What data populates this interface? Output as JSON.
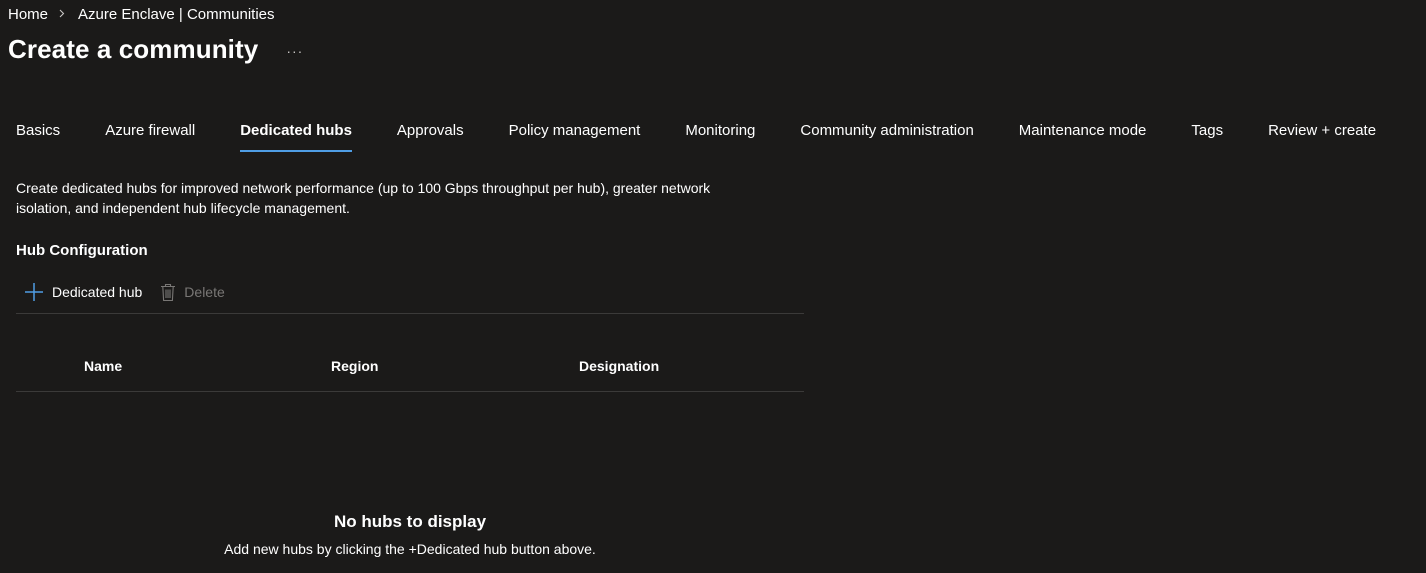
{
  "breadcrumb": {
    "items": [
      "Home",
      "Azure Enclave | Communities"
    ],
    "separator_icon": "chevron-right-icon"
  },
  "header": {
    "title": "Create a community",
    "more_label": "···"
  },
  "tabs": [
    {
      "label": "Basics",
      "active": false
    },
    {
      "label": "Azure firewall",
      "active": false
    },
    {
      "label": "Dedicated hubs",
      "active": true
    },
    {
      "label": "Approvals",
      "active": false
    },
    {
      "label": "Policy management",
      "active": false
    },
    {
      "label": "Monitoring",
      "active": false
    },
    {
      "label": "Community administration",
      "active": false
    },
    {
      "label": "Maintenance mode",
      "active": false
    },
    {
      "label": "Tags",
      "active": false
    },
    {
      "label": "Review + create",
      "active": false
    }
  ],
  "main": {
    "description_line1": "Create dedicated hubs for improved network performance (up to 100 Gbps throughput per hub), greater network",
    "description_line2": "isolation, and independent hub lifecycle management.",
    "section_title": "Hub Configuration",
    "toolbar": {
      "add_label": "Dedicated hub",
      "add_icon": "plus-icon",
      "delete_label": "Delete",
      "delete_icon": "trash-icon"
    },
    "table": {
      "columns": [
        "Name",
        "Region",
        "Designation"
      ],
      "rows": []
    },
    "empty_state": {
      "title": "No hubs to display",
      "subtitle": "Add new hubs by clicking the +Dedicated hub button above."
    }
  },
  "colors": {
    "background": "#1b1a19",
    "accent": "#4f9de4",
    "divider": "#3b3a39",
    "disabled_text": "#797775"
  }
}
